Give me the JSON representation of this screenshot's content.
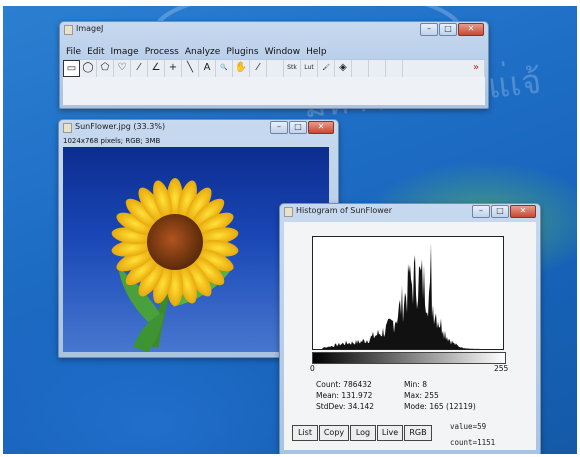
{
  "main_window": {
    "title": "ImageJ",
    "menus": [
      "File",
      "Edit",
      "Image",
      "Process",
      "Analyze",
      "Plugins",
      "Window",
      "Help"
    ],
    "tools": [
      {
        "icon": "rectangle-tool-icon",
        "glyph": "▭"
      },
      {
        "icon": "oval-tool-icon",
        "glyph": "◯"
      },
      {
        "icon": "polygon-tool-icon",
        "glyph": "⬠"
      },
      {
        "icon": "freehand-tool-icon",
        "glyph": "♡"
      },
      {
        "icon": "line-tool-icon",
        "glyph": "⁄"
      },
      {
        "icon": "angle-tool-icon",
        "glyph": "∠"
      },
      {
        "icon": "point-tool-icon",
        "glyph": "+"
      },
      {
        "icon": "wand-tool-icon",
        "glyph": "╲"
      },
      {
        "icon": "text-tool-icon",
        "glyph": "A"
      },
      {
        "icon": "magnifier-tool-icon",
        "glyph": "🔍"
      },
      {
        "icon": "hand-tool-icon",
        "glyph": "✋"
      },
      {
        "icon": "dropper-tool-icon",
        "glyph": "⁄"
      },
      {
        "icon": "blank-tool-icon",
        "glyph": ""
      },
      {
        "icon": "stk-tool-icon",
        "glyph": "Stk"
      },
      {
        "icon": "lut-tool-icon",
        "glyph": "Lut"
      },
      {
        "icon": "brush-tool-icon",
        "glyph": "🖌"
      },
      {
        "icon": "flood-fill-tool-icon",
        "glyph": "◈"
      },
      {
        "icon": "blank-tool-icon",
        "glyph": ""
      },
      {
        "icon": "blank-tool-icon",
        "glyph": ""
      },
      {
        "icon": "blank-tool-icon",
        "glyph": ""
      },
      {
        "icon": "more-tools-icon",
        "glyph": "»"
      }
    ]
  },
  "image_window": {
    "title": "SunFlower.jpg (33.3%)",
    "info": "1024x768 pixels; RGB; 3MB"
  },
  "histogram_window": {
    "title": "Histogram of SunFlower",
    "x_min_label": "0",
    "x_max_label": "255",
    "stats": {
      "count": "Count: 786432",
      "mean": "Mean: 131.972",
      "stddev": "StdDev: 34.142",
      "min": "Min: 8",
      "max": "Max: 255",
      "mode": "Mode: 165 (12119)"
    },
    "buttons": [
      "List",
      "Copy",
      "Log",
      "Live",
      "RGB"
    ],
    "value_text": "value=59",
    "count_text": "count=1151"
  },
  "colors": {
    "accent": "#1a62c0",
    "title_bar": "#b8cde8",
    "close": "#c44a32"
  }
}
